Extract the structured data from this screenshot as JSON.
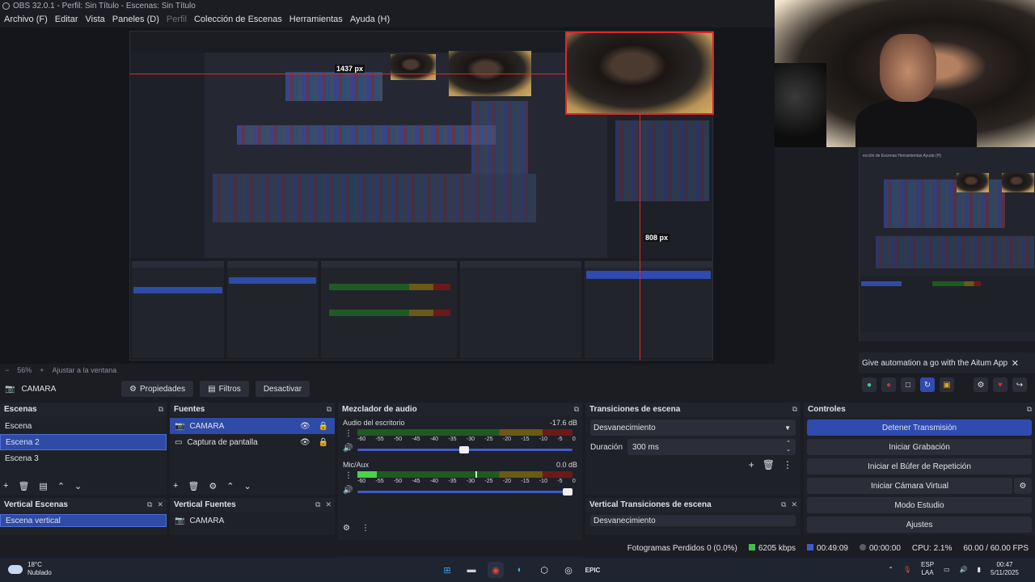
{
  "window": {
    "title": "OBS 32.0.1 - Perfil: Sin Título - Escenas: Sin Título"
  },
  "menu": [
    {
      "label": "Archivo (F)",
      "dim": false
    },
    {
      "label": "Editar",
      "dim": false
    },
    {
      "label": "Vista",
      "dim": false
    },
    {
      "label": "Paneles (D)",
      "dim": false
    },
    {
      "label": "Perfil",
      "dim": true
    },
    {
      "label": "Colección de Escenas",
      "dim": false
    },
    {
      "label": "Herramientas",
      "dim": false
    },
    {
      "label": "Ayuda (H)",
      "dim": false
    }
  ],
  "preview": {
    "measure_top": "1437 px",
    "measure_bottom": "808 px",
    "nested_menu": "ección de Escenas   Herramientas   Ayuda (H)",
    "altum_text": "Give automation a go with the Aitum App",
    "altum_close": "✕"
  },
  "zoom": {
    "level": "56%",
    "fit_label": "Ajustar a la ventana"
  },
  "source_toolbar": {
    "source": "CAMARA",
    "properties": "Propiedades",
    "filters": "Filtros",
    "deactivate": "Desactivar"
  },
  "scenes": {
    "title": "Escenas",
    "items": [
      "Escena",
      "Escena 2",
      "Escena 3"
    ],
    "selected_index": 1
  },
  "sources": {
    "title": "Fuentes",
    "items": [
      {
        "name": "CAMARA",
        "icon": "camera-icon"
      },
      {
        "name": "Captura de pantalla",
        "icon": "monitor-icon"
      }
    ]
  },
  "mixer": {
    "title": "Mezclador de audio",
    "ticks": [
      "-60",
      "-55",
      "-50",
      "-45",
      "-40",
      "-35",
      "-30",
      "-25",
      "-20",
      "-15",
      "-10",
      "-5",
      "0"
    ],
    "channels": [
      {
        "name": "Audio del escritorio",
        "db": "-17.6 dB",
        "level": 0,
        "volume": 0.52
      },
      {
        "name": "Mic/Aux",
        "db": "0.0 dB",
        "level": 0.09,
        "peak": 0.55,
        "volume": 1.0
      }
    ]
  },
  "transitions": {
    "title": "Transiciones de escena",
    "selected": "Desvanecimiento",
    "duration_label": "Duración",
    "duration_value": "300 ms"
  },
  "controls": {
    "title": "Controles",
    "buttons": [
      "Detener Transmisión",
      "Iniciar Grabación",
      "Iniciar el Búfer de Repetición",
      "Iniciar Cámara Virtual",
      "Modo Estudio",
      "Ajustes"
    ]
  },
  "vertical": {
    "scenes_title": "Vertical Escenas",
    "scene_item": "Escena vertical",
    "sources_title": "Vertical Fuentes",
    "source_item": "CAMARA",
    "transitions_title": "Vertical Transiciones de escena",
    "transition_item": "Desvanecimiento"
  },
  "status": {
    "dropped": "Fotogramas Perdidos 0 (0.0%)",
    "bitrate": "6205 kbps",
    "stream_time": "00:49:09",
    "rec_time": "00:00:00",
    "cpu": "CPU: 2.1%",
    "fps": "60.00 / 60.00 FPS"
  },
  "taskbar": {
    "temp": "18°C",
    "weather": "Nublado",
    "lang1": "ESP",
    "lang2": "LAA",
    "time": "00:47",
    "date": "5/11/2025"
  },
  "colors": {
    "accent": "#2f4bb0",
    "selection": "#2e4ba8",
    "measure_red": "#e0262b"
  }
}
